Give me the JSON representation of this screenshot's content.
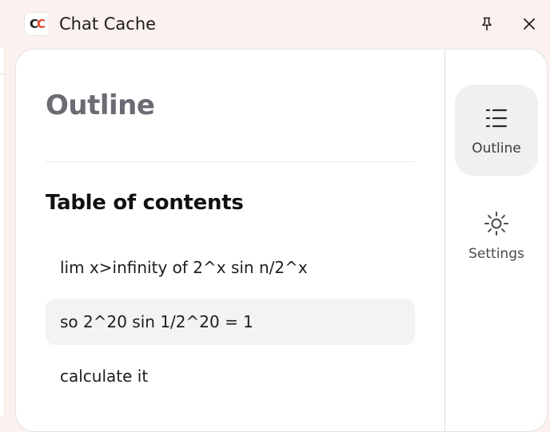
{
  "window": {
    "title": "Chat Cache",
    "logo_text_1": "C",
    "logo_text_2": "C",
    "pin_icon": "pin-icon",
    "close_icon": "close-icon"
  },
  "main": {
    "title": "Outline",
    "toc_heading": "Table of contents",
    "items": [
      {
        "label": "lim x>infinity of 2^x sin n/2^x",
        "active": false
      },
      {
        "label": "so 2^20 sin 1/2^20 = 1",
        "active": true
      },
      {
        "label": "calculate it",
        "active": false
      }
    ]
  },
  "sidebar": {
    "items": [
      {
        "label": "Outline",
        "icon": "list-icon",
        "active": true
      },
      {
        "label": "Settings",
        "icon": "sun-icon",
        "active": false
      }
    ]
  },
  "colors": {
    "titlebar_bg": "#fbf1ee",
    "accent": "#e0492f",
    "active_item_bg": "#f3f3f3"
  }
}
